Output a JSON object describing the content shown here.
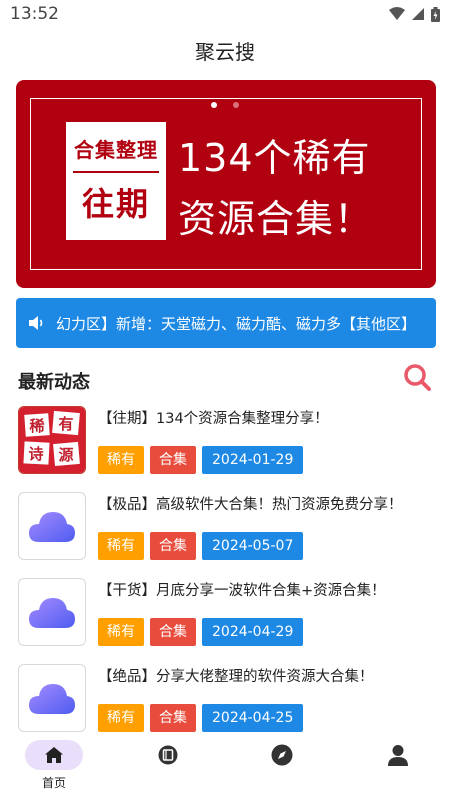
{
  "status_bar": {
    "time": "13:52"
  },
  "app": {
    "title": "聚云搜"
  },
  "banner": {
    "badge_top": "合集整理",
    "badge_bottom": "往期",
    "line1": "134个稀有",
    "line2": "资源合集！",
    "colors": {
      "background": "#b1000f",
      "dot_active": "#ffffff",
      "dot_inactive": "#d9737b"
    }
  },
  "notice": {
    "icon": "speaker-icon",
    "text": "幻力区】新增：天堂磁力、磁力酷、磁力多【其他区】",
    "color": "#1e88e5"
  },
  "latest": {
    "title": "最新动态",
    "search_icon": "search-icon",
    "items": [
      {
        "title": "【往期】134个资源合集整理分享！",
        "thumb": "rare-resources-logo",
        "thumb_chars": [
          "稀",
          "有",
          "诗",
          "源"
        ],
        "tags": [
          "稀有",
          "合集"
        ],
        "date": "2024-01-29"
      },
      {
        "title": "【极品】高级软件大合集！热门资源免费分享！",
        "thumb": "cloud-icon",
        "tags": [
          "稀有",
          "合集"
        ],
        "date": "2024-05-07"
      },
      {
        "title": "【干货】月底分享一波软件合集+资源合集！",
        "thumb": "cloud-icon",
        "tags": [
          "稀有",
          "合集"
        ],
        "date": "2024-04-29"
      },
      {
        "title": "【绝品】分享大佬整理的软件资源大合集！",
        "thumb": "cloud-icon",
        "tags": [
          "稀有",
          "合集"
        ],
        "date": "2024-04-25"
      }
    ]
  },
  "tabbar": {
    "tabs": [
      {
        "icon": "home-icon",
        "label": "首页",
        "active": true
      },
      {
        "icon": "book-icon",
        "label": ""
      },
      {
        "icon": "compass-icon",
        "label": ""
      },
      {
        "icon": "user-icon",
        "label": ""
      }
    ]
  },
  "colors": {
    "orange_tag": "#ffa000",
    "red_tag": "#e74c3c",
    "blue_tag": "#1e88e5"
  }
}
